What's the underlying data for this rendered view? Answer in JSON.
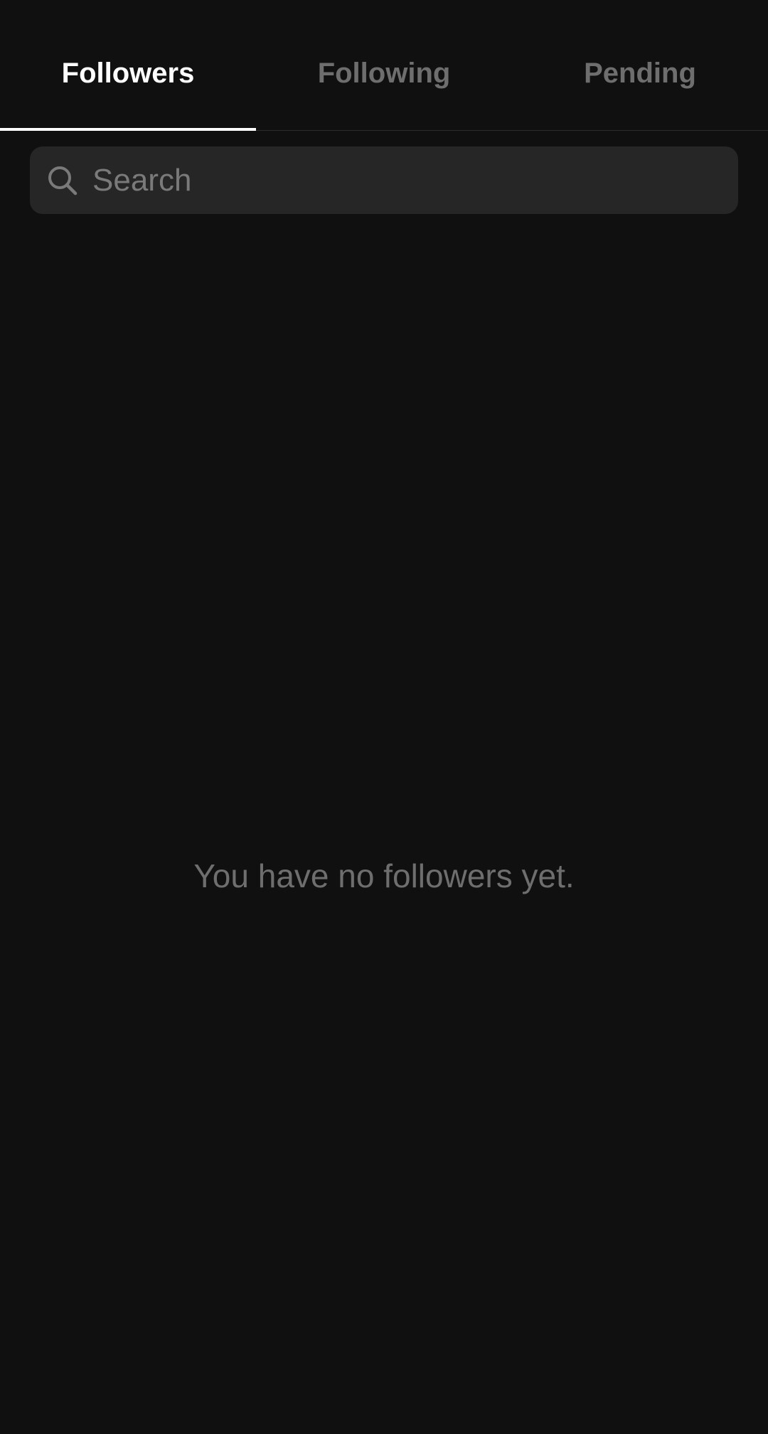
{
  "tabs": [
    {
      "label": "Followers",
      "active": true
    },
    {
      "label": "Following",
      "active": false
    },
    {
      "label": "Pending",
      "active": false
    }
  ],
  "search": {
    "placeholder": "Search",
    "value": "",
    "icon": "search-icon"
  },
  "empty_state": {
    "message": "You have no followers yet."
  },
  "colors": {
    "background": "#101010",
    "active_tab": "#ffffff",
    "inactive_tab": "#6e6e6e",
    "search_background": "#262626",
    "muted_text": "#6e6e6e"
  }
}
